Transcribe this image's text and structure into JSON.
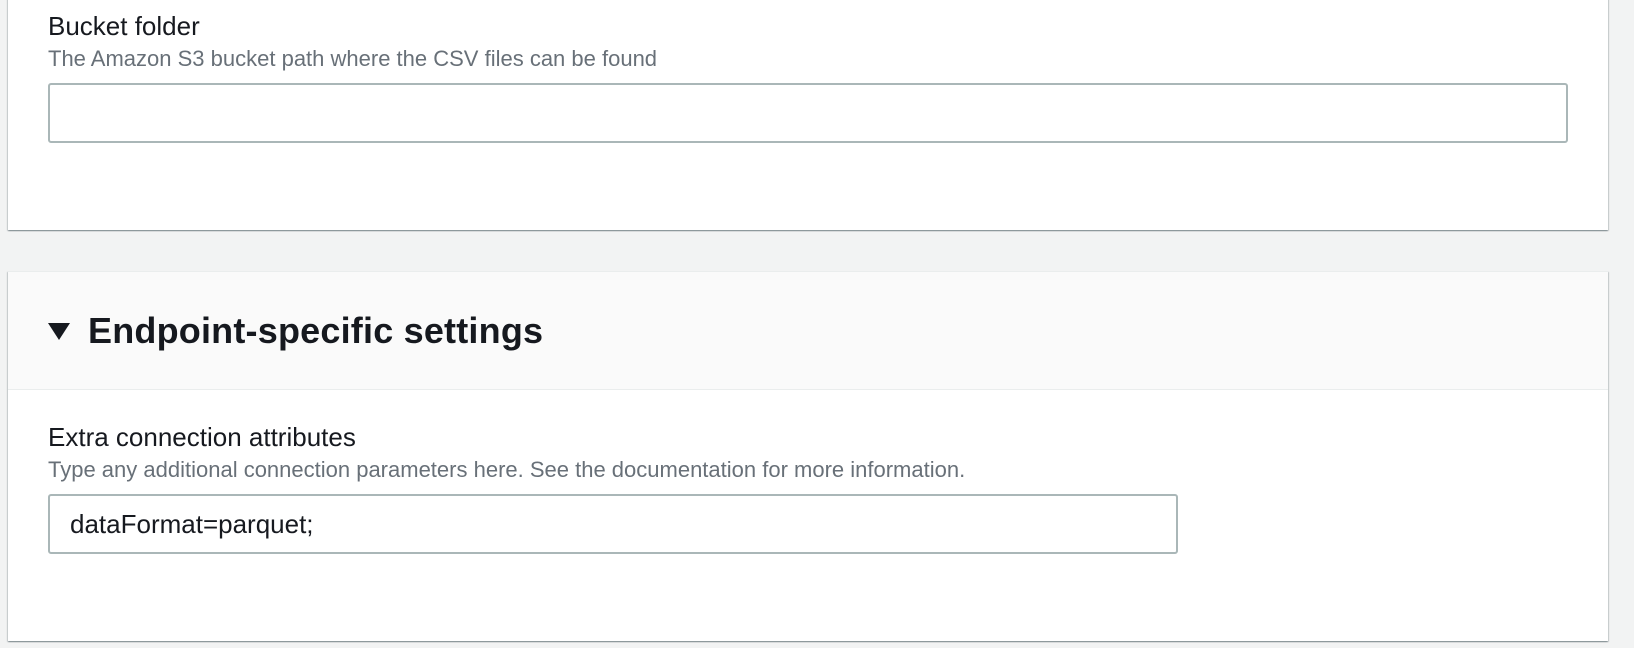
{
  "bucket_folder": {
    "label": "Bucket folder",
    "description": "The Amazon S3 bucket path where the CSV files can be found",
    "value": ""
  },
  "endpoint_settings": {
    "title": "Endpoint-specific settings",
    "expanded": true,
    "extra_attributes": {
      "label": "Extra connection attributes",
      "description": "Type any additional connection parameters here. See the documentation for more information.",
      "value": "dataFormat=parquet;"
    }
  }
}
